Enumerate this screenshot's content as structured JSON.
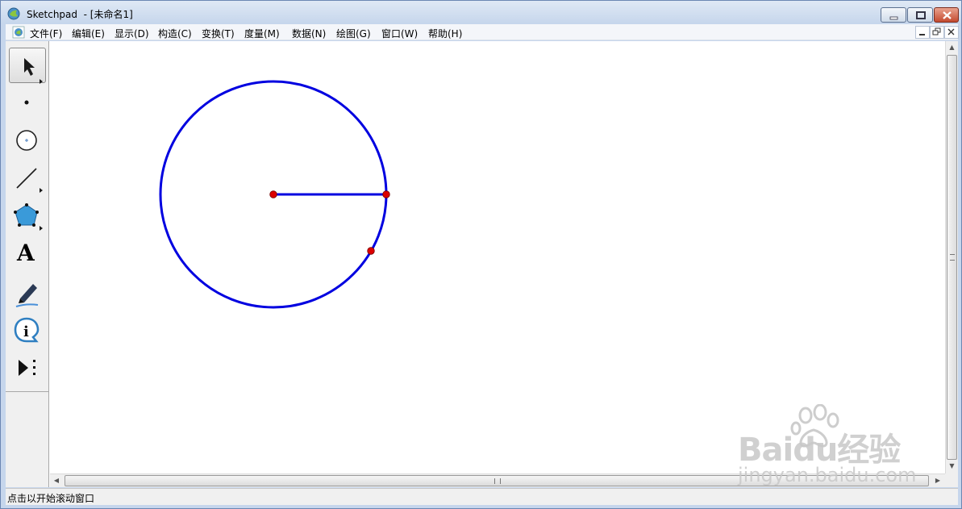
{
  "window": {
    "app_name": "Sketchpad",
    "title": "Sketchpad  - [未命名1]"
  },
  "menu": [
    {
      "label": "文件(F)",
      "name": "menu-file"
    },
    {
      "label": "编辑(E)",
      "name": "menu-edit"
    },
    {
      "label": "显示(D)",
      "name": "menu-display"
    },
    {
      "label": "构造(C)",
      "name": "menu-construct"
    },
    {
      "label": "变换(T)",
      "name": "menu-transform"
    },
    {
      "label": "度量(M)",
      "name": "menu-measure"
    },
    {
      "label": "数据(N)",
      "name": "menu-data"
    },
    {
      "label": "绘图(G)",
      "name": "menu-graph"
    },
    {
      "label": "窗口(W)",
      "name": "menu-window"
    },
    {
      "label": "帮助(H)",
      "name": "menu-help"
    }
  ],
  "toolbox": [
    {
      "name": "selection-arrow-tool",
      "icon": "arrow-icon",
      "active": true
    },
    {
      "name": "point-tool",
      "icon": "point-icon",
      "active": false
    },
    {
      "name": "compass-tool",
      "icon": "circle-icon",
      "active": false
    },
    {
      "name": "straightedge-tool",
      "icon": "line-segment-icon",
      "active": false
    },
    {
      "name": "polygon-tool",
      "icon": "pentagon-icon",
      "active": false
    },
    {
      "name": "text-tool",
      "icon": "letter-a-icon",
      "label": "A",
      "active": false
    },
    {
      "name": "marker-tool",
      "icon": "marker-pen-icon",
      "active": false
    },
    {
      "name": "information-tool",
      "icon": "info-icon",
      "label": "i",
      "active": false
    },
    {
      "name": "custom-tool",
      "icon": "play-custom-icon",
      "active": false
    }
  ],
  "sketch": {
    "circle_color": "#0000e0",
    "point_color": "#dd0000"
  },
  "status": {
    "text": "点击以开始滚动窗口"
  },
  "watermark": {
    "logo": "Baidu经验",
    "url": "jingyan.baidu.com"
  }
}
